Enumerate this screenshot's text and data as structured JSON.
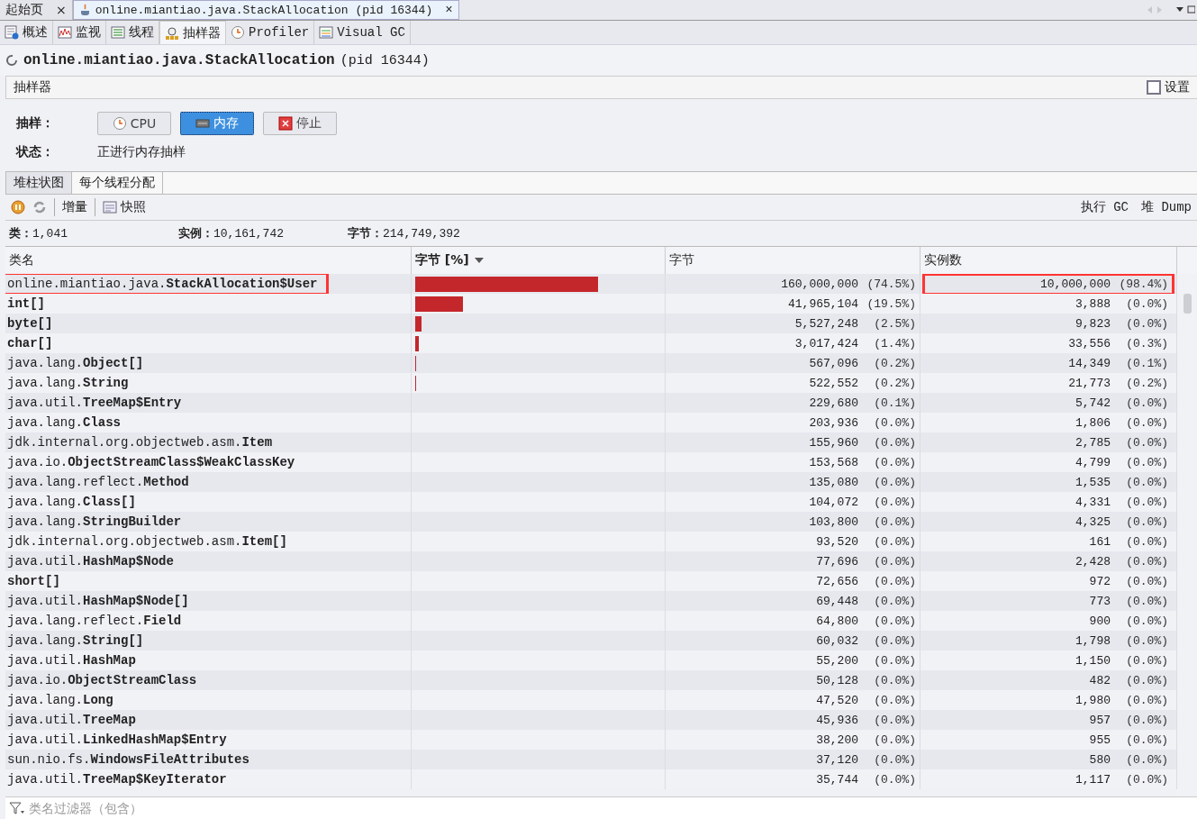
{
  "doc_tabs": [
    {
      "label": "起始页",
      "close": "×",
      "selected": false
    },
    {
      "label": "online.miantiao.java.StackAllocation (pid 16344)",
      "close": "×",
      "selected": true
    }
  ],
  "view_tabs": [
    {
      "label": "概述",
      "selected": false
    },
    {
      "label": "监视",
      "selected": false
    },
    {
      "label": "线程",
      "selected": false
    },
    {
      "label": "抽样器",
      "selected": true
    },
    {
      "label": "Profiler",
      "selected": false
    },
    {
      "label": "Visual GC",
      "selected": false
    }
  ],
  "title": {
    "name": "online.miantiao.java.StackAllocation",
    "pid": "(pid 16344)"
  },
  "panel": {
    "title": "抽样器",
    "settings": {
      "label": "设置",
      "checked": false
    }
  },
  "sample": {
    "label": "抽样：",
    "buttons": [
      {
        "label": "CPU",
        "selected": false
      },
      {
        "label": "内存",
        "selected": true
      },
      {
        "label": "停止",
        "selected": false
      }
    ]
  },
  "status": {
    "label": "状态：",
    "value": "正进行内存抽样"
  },
  "sub_tabs": [
    {
      "label": "堆柱状图",
      "selected": true
    },
    {
      "label": "每个线程分配",
      "selected": false
    }
  ],
  "toolbar": {
    "delta": "增量",
    "snapshot": "快照",
    "gc": "执行 GC",
    "dump": "堆 Dump"
  },
  "stats": [
    {
      "label": "类：",
      "value": "1,041"
    },
    {
      "label": "实例：",
      "value": "10,161,742"
    },
    {
      "label": "字节：",
      "value": "214,749,392"
    }
  ],
  "table": {
    "columns": [
      "类名",
      "字节 [%]",
      "字节",
      "实例数"
    ],
    "rows": [
      {
        "package": "online.miantiao.java.",
        "class": "StackAllocation$User",
        "level": 0.745,
        "bytes": "160,000,000",
        "bytes_pct": "(74.5%)",
        "instances": "10,000,000",
        "inst_pct": "(98.4%)",
        "highlighted": true
      },
      {
        "class": "int[]",
        "level": 0.195,
        "bytes": "41,965,104",
        "bytes_pct": "(19.5%)",
        "instances": "3,888",
        "inst_pct": "(0.0%)",
        "highlighted": false
      },
      {
        "class": "byte[]",
        "level": 0.025,
        "bytes": "5,527,248",
        "bytes_pct": "(2.5%)",
        "instances": "9,823",
        "inst_pct": "(0.0%)",
        "highlighted": false
      },
      {
        "class": "char[]",
        "level": 0.014,
        "bytes": "3,017,424",
        "bytes_pct": "(1.4%)",
        "instances": "33,556",
        "inst_pct": "(0.3%)",
        "highlighted": false
      },
      {
        "package": "java.lang.",
        "class": "Object[]",
        "level": 0.004,
        "bytes": "567,096",
        "bytes_pct": "(0.2%)",
        "instances": "14,349",
        "inst_pct": "(0.1%)",
        "highlighted": false
      },
      {
        "package": "java.lang.",
        "class": "String",
        "level": 0.004,
        "bytes": "522,552",
        "bytes_pct": "(0.2%)",
        "instances": "21,773",
        "inst_pct": "(0.2%)",
        "highlighted": false
      },
      {
        "package": "java.util.",
        "class": "TreeMap$Entry",
        "bytes": "229,680",
        "bytes_pct": "(0.1%)",
        "instances": "5,742",
        "inst_pct": "(0.0%)",
        "highlighted": false
      },
      {
        "package": "java.lang.",
        "class": "Class",
        "bytes": "203,936",
        "bytes_pct": "(0.0%)",
        "instances": "1,806",
        "inst_pct": "(0.0%)",
        "highlighted": false
      },
      {
        "package": "jdk.internal.org.objectweb.asm.",
        "class": "Item",
        "bytes": "155,960",
        "bytes_pct": "(0.0%)",
        "instances": "2,785",
        "inst_pct": "(0.0%)",
        "highlighted": false
      },
      {
        "package": "java.io.",
        "class": "ObjectStreamClass$WeakClassKey",
        "bytes": "153,568",
        "bytes_pct": "(0.0%)",
        "instances": "4,799",
        "inst_pct": "(0.0%)",
        "highlighted": false
      },
      {
        "package": "java.lang.reflect.",
        "class": "Method",
        "bytes": "135,080",
        "bytes_pct": "(0.0%)",
        "instances": "1,535",
        "inst_pct": "(0.0%)",
        "highlighted": false
      },
      {
        "package": "java.lang.",
        "class": "Class[]",
        "bytes": "104,072",
        "bytes_pct": "(0.0%)",
        "instances": "4,331",
        "inst_pct": "(0.0%)",
        "highlighted": false
      },
      {
        "package": "java.lang.",
        "class": "StringBuilder",
        "bytes": "103,800",
        "bytes_pct": "(0.0%)",
        "instances": "4,325",
        "inst_pct": "(0.0%)",
        "highlighted": false
      },
      {
        "package": "jdk.internal.org.objectweb.asm.",
        "class": "Item[]",
        "bytes": "93,520",
        "bytes_pct": "(0.0%)",
        "instances": "161",
        "inst_pct": "(0.0%)",
        "highlighted": false
      },
      {
        "package": "java.util.",
        "class": "HashMap$Node",
        "bytes": "77,696",
        "bytes_pct": "(0.0%)",
        "instances": "2,428",
        "inst_pct": "(0.0%)",
        "highlighted": false
      },
      {
        "class": "short[]",
        "bytes": "72,656",
        "bytes_pct": "(0.0%)",
        "instances": "972",
        "inst_pct": "(0.0%)",
        "highlighted": false
      },
      {
        "package": "java.util.",
        "class": "HashMap$Node[]",
        "bytes": "69,448",
        "bytes_pct": "(0.0%)",
        "instances": "773",
        "inst_pct": "(0.0%)",
        "highlighted": false
      },
      {
        "package": "java.lang.reflect.",
        "class": "Field",
        "bytes": "64,800",
        "bytes_pct": "(0.0%)",
        "instances": "900",
        "inst_pct": "(0.0%)",
        "highlighted": false
      },
      {
        "package": "java.lang.",
        "class": "String[]",
        "bytes": "60,032",
        "bytes_pct": "(0.0%)",
        "instances": "1,798",
        "inst_pct": "(0.0%)",
        "highlighted": false
      },
      {
        "package": "java.util.",
        "class": "HashMap",
        "bytes": "55,200",
        "bytes_pct": "(0.0%)",
        "instances": "1,150",
        "inst_pct": "(0.0%)",
        "highlighted": false
      },
      {
        "package": "java.io.",
        "class": "ObjectStreamClass",
        "bytes": "50,128",
        "bytes_pct": "(0.0%)",
        "instances": "482",
        "inst_pct": "(0.0%)",
        "highlighted": false
      },
      {
        "package": "java.lang.",
        "class": "Long",
        "bytes": "47,520",
        "bytes_pct": "(0.0%)",
        "instances": "1,980",
        "inst_pct": "(0.0%)",
        "highlighted": false
      },
      {
        "package": "java.util.",
        "class": "TreeMap",
        "bytes": "45,936",
        "bytes_pct": "(0.0%)",
        "instances": "957",
        "inst_pct": "(0.0%)",
        "highlighted": false
      },
      {
        "package": "java.util.",
        "class": "LinkedHashMap$Entry",
        "bytes": "38,200",
        "bytes_pct": "(0.0%)",
        "instances": "955",
        "inst_pct": "(0.0%)",
        "highlighted": false
      },
      {
        "package": "sun.nio.fs.",
        "class": "WindowsFileAttributes",
        "bytes": "37,120",
        "bytes_pct": "(0.0%)",
        "instances": "580",
        "inst_pct": "(0.0%)",
        "highlighted": false
      },
      {
        "package": "java.util.",
        "class": "TreeMap$KeyIterator",
        "bytes": "35,744",
        "bytes_pct": "(0.0%)",
        "instances": "1,117",
        "inst_pct": "(0.0%)",
        "highlighted": false
      }
    ]
  },
  "filter": {
    "placeholder": "类名过滤器（包含）"
  }
}
